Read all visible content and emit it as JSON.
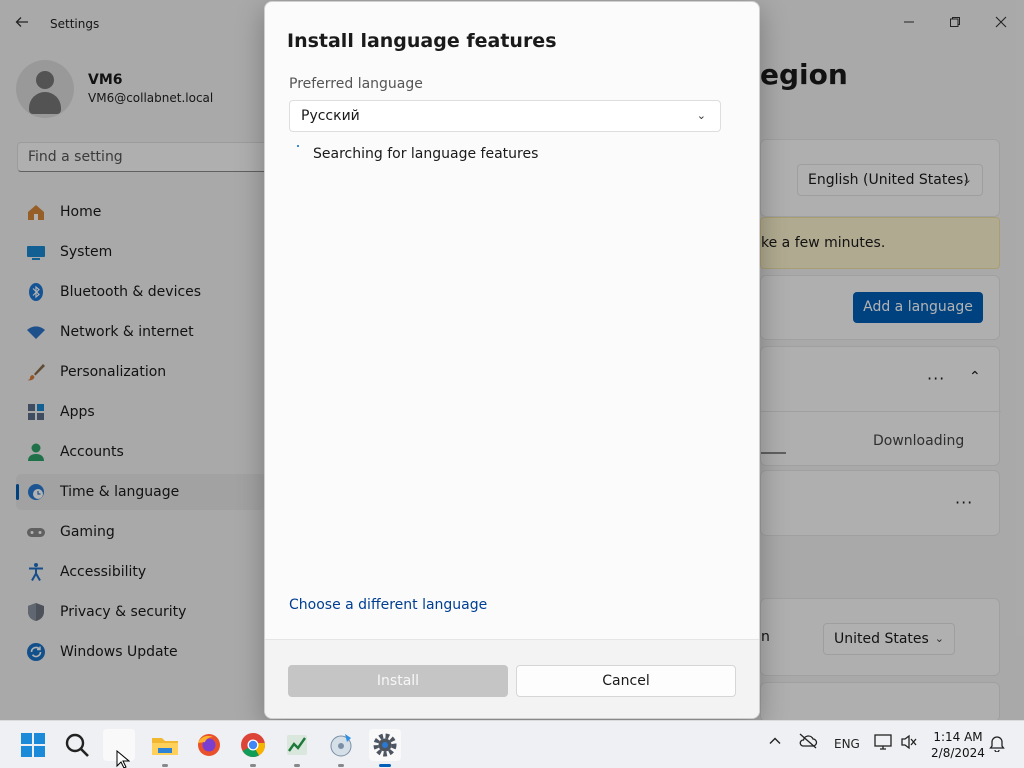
{
  "settings": {
    "window_title": "Settings",
    "user": {
      "name": "VM6",
      "email": "VM6@collabnet.local"
    },
    "search_placeholder": "Find a setting",
    "nav": [
      {
        "label": "Home",
        "icon": "home-icon",
        "color": "#d9893a"
      },
      {
        "label": "System",
        "icon": "system-icon",
        "color": "#1b8ad3"
      },
      {
        "label": "Bluetooth & devices",
        "icon": "bluetooth-icon",
        "color": "#1e78d4"
      },
      {
        "label": "Network & internet",
        "icon": "wifi-icon",
        "color": "#2b73c9"
      },
      {
        "label": "Personalization",
        "icon": "brush-icon",
        "color": "#d87b3d"
      },
      {
        "label": "Apps",
        "icon": "apps-icon",
        "color": "#5c6d8a"
      },
      {
        "label": "Accounts",
        "icon": "accounts-icon",
        "color": "#2fa36a"
      },
      {
        "label": "Time & language",
        "icon": "clock-globe-icon",
        "color": "#2a7ad1"
      },
      {
        "label": "Gaming",
        "icon": "gamepad-icon",
        "color": "#8a8a8a"
      },
      {
        "label": "Accessibility",
        "icon": "accessibility-icon",
        "color": "#1f6fc6"
      },
      {
        "label": "Privacy & security",
        "icon": "shield-icon",
        "color": "#6d7582"
      },
      {
        "label": "Windows Update",
        "icon": "update-icon",
        "color": "#1a73c8"
      }
    ],
    "page_title_partial": "egion",
    "display_language_value": "English (United States)",
    "warning_partial": "ke a few minutes.",
    "add_language_label": "Add a language",
    "downloading_label": "Downloading",
    "country_value": "United States",
    "partial_setting_label": "n"
  },
  "dialog": {
    "title": "Install language features",
    "preferred_language_label": "Preferred language",
    "preferred_language_value": "Русский",
    "status_text": "Searching for language features",
    "choose_link": "Choose a different language",
    "install_label": "Install",
    "cancel_label": "Cancel"
  },
  "taskbar": {
    "language": "ENG",
    "time": "1:14 AM",
    "date": "2/8/2024"
  },
  "colors": {
    "accent": "#005fb8",
    "link": "#003e92"
  }
}
